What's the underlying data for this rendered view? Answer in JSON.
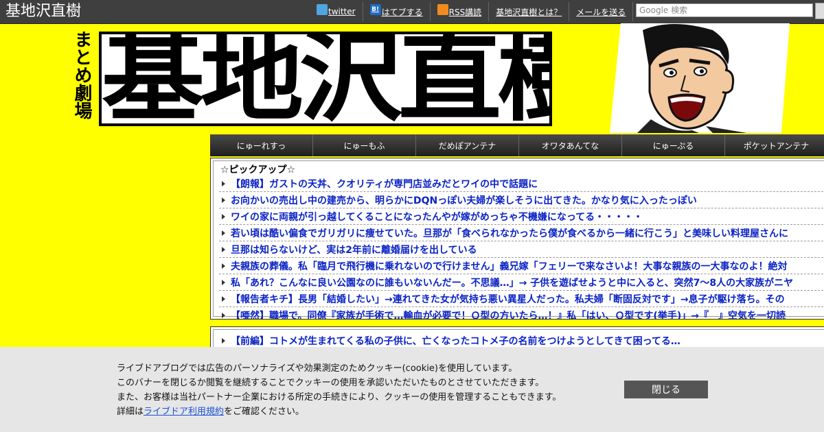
{
  "topbar": {
    "site_title": "基地沢直樹",
    "links": [
      {
        "label": "twitter",
        "icon": "twitter-icon"
      },
      {
        "label": "はてブする",
        "icon": "hatena-bookmark-icon",
        "icon_text": "B!"
      },
      {
        "label": "RSS講読",
        "icon": "rss-icon"
      },
      {
        "label": "基地沢直樹とは？"
      },
      {
        "label": "メールを送る"
      }
    ],
    "search_placeholder": "Google 検索"
  },
  "header": {
    "tagline": "まとめ劇場",
    "logo_text": "基地沢直樹"
  },
  "tabs": [
    "にゅーれすっ",
    "にゅーもふ",
    "だめぽアンテナ",
    "オワタあんてな",
    "にゅーぷる",
    "ポケットアンテナ"
  ],
  "pickup": {
    "title": "☆ピックアップ☆",
    "items": [
      "【朗報】ガストの天丼、クオリティが専門店並みだとワイの中で話題に",
      "お向かいの売出し中の建売から、明らかにDQNっぽい夫婦が楽しそうに出てきた。かなり気に入ったっぽい",
      "ワイの家に両親が引っ越してくることになったんやが嫁がめっちゃ不機嫌になってる・・・・・",
      "若い頃は酷い偏食でガリガリに痩せていた。旦那が「食べられなかったら僕が食べるから一緒に行こう」と美味しい料理屋さんに",
      "旦那は知らないけど、実は2年前に離婚届けを出している",
      "夫親族の葬儀。私「臨月で飛行機に乗れないので行けません」義兄嫁「フェリーで来なさいよ！大事な親族の一大事なのよ！絶対",
      "私「あれ？こんなに良い公園なのに誰もいないんだー。不思議…」→ 子供を遊ばせようと中に入ると、突然7～8人の大家族がニヤ",
      "【報告者キチ】長男「結婚したい」→連れてきた女が気持ち悪い異星人だった。私夫婦「断固反対です」→息子が駆け落ち。その",
      "【唖然】職場で。同僚『家族が手術で…輸血が必要で！Ｏ型の方いたら…！』私「はい、Ｏ型です(挙手)」→『　』空気を一切読"
    ]
  },
  "featured": {
    "item": "【前編】コトメが生まれてくる私の子供に、亡くなったコトメ子の名前をつけようとしてきて困ってる…"
  },
  "cookie": {
    "line1": "ライブドアブログでは広告のパーソナライズや効果測定のためクッキー(cookie)を使用しています。",
    "line2": "このバナーを閉じるか閲覧を継続することでクッキーの使用を承認いただいたものとさせていただきます。",
    "line3": "また、お客様は当社パートナー企業における所定の手続きにより、クッキーの使用を管理することもできます。",
    "line4_prefix": "詳細は",
    "line4_link": "ライブドア利用規約",
    "line4_suffix": "をご確認ください。",
    "close_label": "閉じる"
  },
  "colors": {
    "background": "#ffff00",
    "topbar": "#3f3f3f",
    "link": "#0b23c4",
    "close_button": "#555555"
  }
}
